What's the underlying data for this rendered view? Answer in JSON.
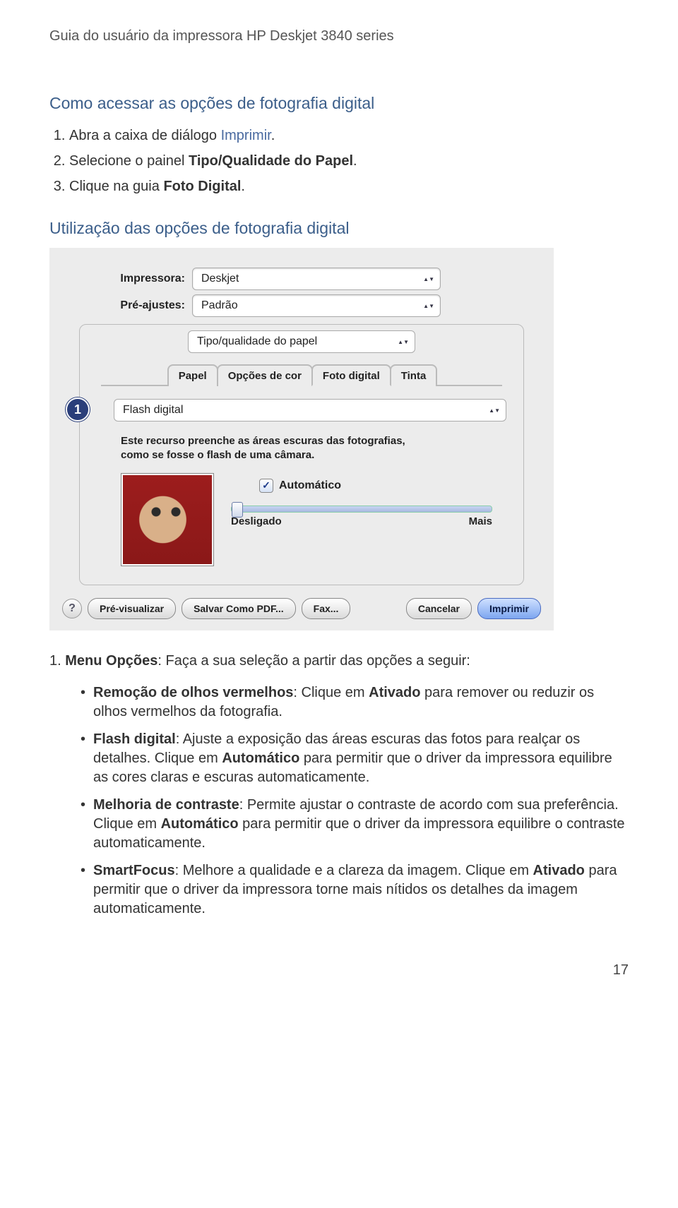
{
  "header": "Guia do usuário da impressora HP Deskjet 3840 series",
  "section1": {
    "title": "Como acessar as opções de fotografia digital",
    "steps": [
      {
        "pre": "Abra a caixa de diálogo ",
        "link": "Imprimir",
        "post": "."
      },
      {
        "pre": "Selecione o painel ",
        "bold": "Tipo/Qualidade do Papel",
        "post": "."
      },
      {
        "pre": "Clique na guia ",
        "bold": "Foto Digital",
        "post": "."
      }
    ]
  },
  "section2": {
    "title": "Utilização das opções de fotografia digital"
  },
  "dialog": {
    "printer_label": "Impressora:",
    "printer_value": "Deskjet",
    "presets_label": "Pré-ajustes:",
    "presets_value": "Padrão",
    "panel_value": "Tipo/qualidade do papel",
    "tabs": [
      "Papel",
      "Opções de cor",
      "Foto digital",
      "Tinta"
    ],
    "active_tab_index": 2,
    "callout": "1",
    "option_value": "Flash digital",
    "description": "Este recurso preenche as áreas escuras das fotografias, como se fosse o flash de uma câmara.",
    "auto_label": "Automático",
    "slider_min": "Desligado",
    "slider_max": "Mais",
    "buttons": {
      "help": "?",
      "preview": "Pré-visualizar",
      "save_pdf": "Salvar Como PDF...",
      "fax": "Fax...",
      "cancel": "Cancelar",
      "print": "Imprimir"
    }
  },
  "menu_intro": {
    "num": "1. ",
    "bold": "Menu Opções",
    "rest": ": Faça a sua seleção a partir das opções a seguir:"
  },
  "bullets": [
    {
      "b1": "Remoção de olhos vermelhos",
      "t1": ": Clique em ",
      "b2": "Ativado",
      "t2": " para remover ou reduzir os olhos vermelhos da fotografia."
    },
    {
      "b1": "Flash digital",
      "t1": ": Ajuste a exposição das áreas escuras das fotos para realçar os detalhes. Clique em ",
      "b2": "Automático",
      "t2": " para permitir que o driver da impressora equilibre as cores claras e escuras automaticamente."
    },
    {
      "b1": "Melhoria de contraste",
      "t1": ": Permite ajustar o contraste de acordo com sua preferência. Clique em ",
      "b2": "Automático",
      "t2": " para permitir que o driver da impressora equilibre o contraste automaticamente."
    },
    {
      "b1": "SmartFocus",
      "t1": ": Melhore a qualidade e a clareza da imagem. Clique em ",
      "b2": "Ativado",
      "t2": " para permitir que o driver da impressora torne mais nítidos os detalhes da imagem automaticamente."
    }
  ],
  "page_number": "17"
}
